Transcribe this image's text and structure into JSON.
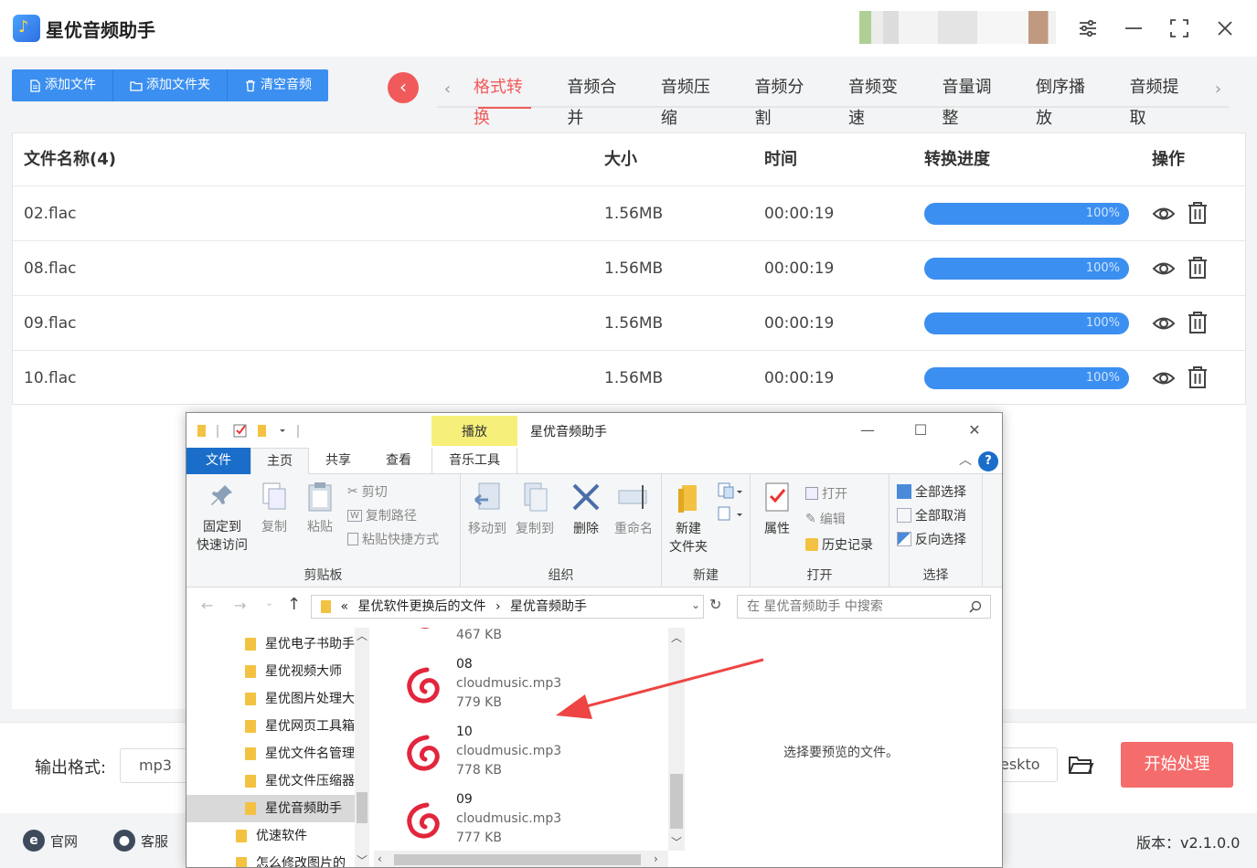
{
  "app": {
    "title": "星优音频助手",
    "version": "版本：v2.1.0.0"
  },
  "toolbar": {
    "add_file": "添加文件",
    "add_folder": "添加文件夹",
    "clear": "清空音频"
  },
  "tabs": [
    "格式转换",
    "音频合并",
    "音频压缩",
    "音频分割",
    "音频变速",
    "音量调整",
    "倒序播放",
    "音频提取"
  ],
  "table": {
    "headers": {
      "name": "文件名称(4)",
      "size": "大小",
      "time": "时间",
      "progress": "转换进度",
      "ops": "操作"
    },
    "rows": [
      {
        "name": "02.flac",
        "size": "1.56MB",
        "time": "00:00:19",
        "progress": "100%",
        "progress_value": 100
      },
      {
        "name": "08.flac",
        "size": "1.56MB",
        "time": "00:00:19",
        "progress": "100%",
        "progress_value": 100
      },
      {
        "name": "09.flac",
        "size": "1.56MB",
        "time": "00:00:19",
        "progress": "100%",
        "progress_value": 100
      },
      {
        "name": "10.flac",
        "size": "1.56MB",
        "time": "00:00:19",
        "progress": "100%",
        "progress_value": 100
      }
    ]
  },
  "bottom": {
    "output_label": "输出格式:",
    "output_value": "mp3",
    "path_value": "eskto",
    "start": "开始处理"
  },
  "footer": {
    "website": "官网",
    "service": "客服"
  },
  "explorer": {
    "title": "星优音频助手",
    "play_tab": "播放",
    "ribbon_tabs": {
      "file": "文件",
      "home": "主页",
      "share": "共享",
      "view": "查看",
      "music": "音乐工具"
    },
    "clipboard": {
      "pin_line1": "固定到",
      "pin_line2": "快速访问",
      "copy": "复制",
      "paste": "粘贴",
      "cut": "剪切",
      "copy_path": "复制路径",
      "paste_shortcut": "粘贴快捷方式",
      "label": "剪贴板"
    },
    "organize": {
      "move": "移动到",
      "copyto": "复制到",
      "delete": "删除",
      "rename": "重命名",
      "label": "组织"
    },
    "new": {
      "folder_line1": "新建",
      "folder_line2": "文件夹",
      "label": "新建"
    },
    "open": {
      "props": "属性",
      "open": "打开",
      "edit": "编辑",
      "history": "历史记录",
      "label": "打开"
    },
    "select": {
      "all": "全部选择",
      "none": "全部取消",
      "invert": "反向选择",
      "label": "选择"
    },
    "address": {
      "prefix": "«",
      "part1": "星优软件更换后的文件",
      "sep": "›",
      "part2": "星优音频助手"
    },
    "search_placeholder": "在 星优音频助手 中搜索",
    "nav": [
      "星优电子书助手",
      "星优视频大师",
      "星优图片处理大师",
      "星优网页工具箱",
      "星优文件名管理",
      "星优文件压缩器",
      "星优音频助手",
      "优速软件",
      "怎么修改图片的"
    ],
    "files": [
      {
        "top_meta": "467 KB"
      },
      {
        "name": "08",
        "type": "cloudmusic.mp3",
        "size": "779 KB"
      },
      {
        "name": "10",
        "type": "cloudmusic.mp3",
        "size": "778 KB"
      },
      {
        "name": "09",
        "type": "cloudmusic.mp3",
        "size": "777 KB"
      }
    ],
    "preview_text": "选择要预览的文件。"
  },
  "colors": {
    "accent_blue": "#3b8ff0",
    "accent_red": "#f05a5a",
    "start_button": "#f56c6c",
    "arrow": "#ee4444",
    "netease": "#e2263d"
  }
}
